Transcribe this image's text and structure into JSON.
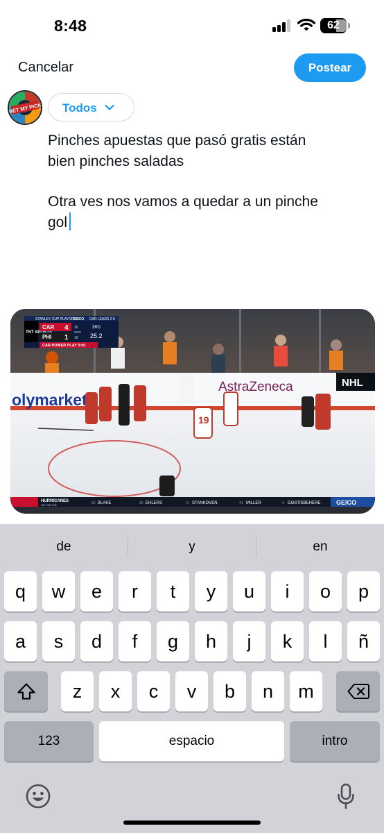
{
  "status_bar": {
    "time": "8:48",
    "battery": "62"
  },
  "compose": {
    "cancel_label": "Cancelar",
    "post_label": "Postear",
    "avatar_text": "BET MY PICK",
    "audience_label": "Todos",
    "text_lines": [
      "Pinches apuestas que pasó gratis están",
      "bien pinches saladas",
      "Otra ves nos vamos a quedar a un pinche",
      "gol"
    ]
  },
  "media": {
    "network": "TNT SPORTS",
    "series_header": "STANLEY CUP PLAYOFFS",
    "geico_header": "GEICO",
    "series_status": "CAR LEADS 2-0",
    "teams": [
      {
        "abbr": "CAR",
        "score": "4",
        "sog_label": "30"
      },
      {
        "abbr": "PHI",
        "score": "1",
        "sog_label": "19"
      }
    ],
    "sog_text": "SOG",
    "period": "3RD",
    "clock": "25.2",
    "power_play": "CAR POWER PLAY 0:06",
    "boards_left": "olymarket",
    "boards_sponsor": "AstraZeneca",
    "boards_logo": "NHL",
    "player_number": "19",
    "ticker_label": "HURRICANES",
    "ticker_sub": "ON THE ICE",
    "ticker_players": [
      {
        "num": "53",
        "name": "BLAKE"
      },
      {
        "num": "26",
        "name": "EHLERS"
      },
      {
        "num": "8",
        "name": "STANKOVEN"
      },
      {
        "num": "41",
        "name": "MILLER"
      },
      {
        "num": "4",
        "name": "GOSTISBEHERE"
      }
    ],
    "ticker_sponsor": "GEICO"
  },
  "keyboard": {
    "suggestions": [
      "de",
      "y",
      "en"
    ],
    "row1": [
      "q",
      "w",
      "e",
      "r",
      "t",
      "y",
      "u",
      "i",
      "o",
      "p"
    ],
    "row2": [
      "a",
      "s",
      "d",
      "f",
      "g",
      "h",
      "j",
      "k",
      "l",
      "ñ"
    ],
    "row3": [
      "z",
      "x",
      "c",
      "v",
      "b",
      "n",
      "m"
    ],
    "numbers_label": "123",
    "space_label": "espacio",
    "return_label": "intro",
    "icons": {
      "shift": "shift-icon",
      "delete": "delete-icon",
      "emoji": "emoji-icon",
      "mic": "mic-icon"
    }
  },
  "colors": {
    "accent": "#1d9bf0",
    "keyboard_bg": "#d1d3d9",
    "key_fn": "#abafb8"
  }
}
